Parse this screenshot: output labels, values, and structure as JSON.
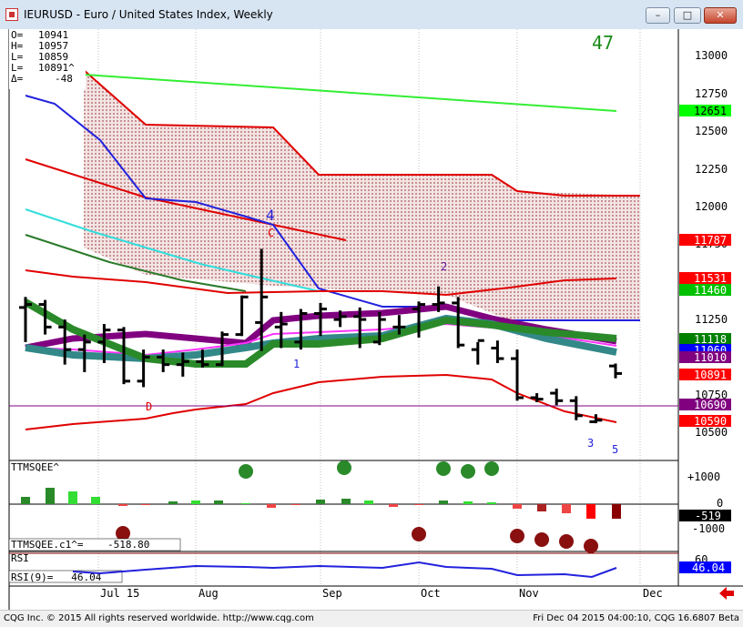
{
  "window": {
    "title": "IEURUSD - Euro / United States Index, Weekly",
    "min_glyph": "–",
    "max_glyph": "□",
    "close_glyph": "✕"
  },
  "ohlc": {
    "o_label": "O=",
    "o_value": "10941",
    "h_label": "H=",
    "h_value": "10957",
    "l_label": "L=",
    "l_value": "10859",
    "last_label": "L=",
    "last_value": "10891^",
    "d_label": "Δ=",
    "d_value": "-48"
  },
  "count_label": "47",
  "price_axis": {
    "ticks": [
      "13000",
      "12750",
      "12500",
      "12250",
      "12000",
      "11750",
      "11500",
      "11250",
      "11000",
      "10750",
      "10500"
    ],
    "badges": [
      {
        "text": "12651",
        "bg": "#00ff00",
        "fg": "#000000"
      },
      {
        "text": "11787",
        "bg": "#ff0000",
        "fg": "#ffffff"
      },
      {
        "text": "11531",
        "bg": "#ff0000",
        "fg": "#ffffff"
      },
      {
        "text": "11460",
        "bg": "#00c000",
        "fg": "#ffffff"
      },
      {
        "text": "11118",
        "bg": "#008000",
        "fg": "#ffffff"
      },
      {
        "text": "11060",
        "bg": "#0000ff",
        "fg": "#ffffff"
      },
      {
        "text": "11010",
        "bg": "#800080",
        "fg": "#ffffff"
      },
      {
        "text": "10891",
        "bg": "#ff0000",
        "fg": "#ffffff"
      },
      {
        "text": "10690",
        "bg": "#800080",
        "fg": "#ffffff"
      },
      {
        "text": "10590",
        "bg": "#ff0000",
        "fg": "#ffffff"
      }
    ]
  },
  "wave_labels": {
    "four": "4",
    "c": "C",
    "one": "1",
    "two": "2",
    "d": "D",
    "three": "3",
    "five": "5"
  },
  "ttm": {
    "title": "TTMSQEE^",
    "readout": "TTMSQEE.c1^=    -518.80",
    "ticks": [
      "+1000",
      "0",
      "-1000"
    ],
    "badge": {
      "text": "-519",
      "bg": "#000000",
      "fg": "#ffffff"
    }
  },
  "rsi": {
    "title": "RSI",
    "readout": "RSI(9)=   46.04",
    "tick": "60",
    "badge": {
      "text": "46.04",
      "bg": "#0000ff",
      "fg": "#ffffff"
    }
  },
  "time_axis": [
    "Jul 15",
    "Aug",
    "Sep",
    "Oct",
    "Nov",
    "Dec"
  ],
  "statusbar": {
    "left": "CQG Inc. © 2015 All rights reserved worldwide. http://www.cqg.com",
    "right": "Fri Dec 04 2015 04:00:10, CQG 16.6807 Beta"
  },
  "chart_data": {
    "type": "candlestick",
    "instrument": "IEURUSD",
    "interval": "Weekly",
    "price_range": [
      10400,
      13200
    ],
    "bars": [
      {
        "o": 11330,
        "h": 11400,
        "l": 11100,
        "c": 11350
      },
      {
        "o": 11350,
        "h": 11380,
        "l": 11150,
        "c": 11200
      },
      {
        "o": 11200,
        "h": 11250,
        "l": 10950,
        "c": 11050
      },
      {
        "o": 11050,
        "h": 11150,
        "l": 10900,
        "c": 11100
      },
      {
        "o": 11100,
        "h": 11220,
        "l": 10960,
        "c": 11180
      },
      {
        "o": 11180,
        "h": 11200,
        "l": 10820,
        "c": 10840
      },
      {
        "o": 10840,
        "h": 11050,
        "l": 10800,
        "c": 11000
      },
      {
        "o": 11000,
        "h": 11050,
        "l": 10900,
        "c": 10950
      },
      {
        "o": 10950,
        "h": 11030,
        "l": 10870,
        "c": 10970
      },
      {
        "o": 10970,
        "h": 11050,
        "l": 10930,
        "c": 10950
      },
      {
        "o": 10950,
        "h": 11170,
        "l": 10940,
        "c": 11150
      },
      {
        "o": 11150,
        "h": 11410,
        "l": 11140,
        "c": 11400
      },
      {
        "o": 11230,
        "h": 11720,
        "l": 11040,
        "c": 11400
      },
      {
        "o": 11200,
        "h": 11300,
        "l": 11060,
        "c": 11220
      },
      {
        "o": 11100,
        "h": 11320,
        "l": 11050,
        "c": 11290
      },
      {
        "o": 11290,
        "h": 11360,
        "l": 11140,
        "c": 11320
      },
      {
        "o": 11250,
        "h": 11310,
        "l": 11200,
        "c": 11270
      },
      {
        "o": 11270,
        "h": 11330,
        "l": 11060,
        "c": 11250
      },
      {
        "o": 11100,
        "h": 11300,
        "l": 11080,
        "c": 11250
      },
      {
        "o": 11200,
        "h": 11280,
        "l": 11150,
        "c": 11200
      },
      {
        "o": 11320,
        "h": 11370,
        "l": 11130,
        "c": 11350
      },
      {
        "o": 11350,
        "h": 11470,
        "l": 11300,
        "c": 11360
      },
      {
        "o": 11360,
        "h": 11400,
        "l": 11060,
        "c": 11080
      },
      {
        "o": 11050,
        "h": 11100,
        "l": 10950,
        "c": 11110
      },
      {
        "o": 11060,
        "h": 11110,
        "l": 10960,
        "c": 10990
      },
      {
        "o": 10990,
        "h": 11050,
        "l": 10710,
        "c": 10730
      },
      {
        "o": 10730,
        "h": 10760,
        "l": 10700,
        "c": 10720
      },
      {
        "o": 10760,
        "h": 10790,
        "l": 10680,
        "c": 10710
      },
      {
        "o": 10710,
        "h": 10740,
        "l": 10580,
        "c": 10610
      },
      {
        "o": 10570,
        "h": 10620,
        "l": 10560,
        "c": 10580
      },
      {
        "o": 10941,
        "h": 10957,
        "l": 10859,
        "c": 10891
      }
    ]
  }
}
